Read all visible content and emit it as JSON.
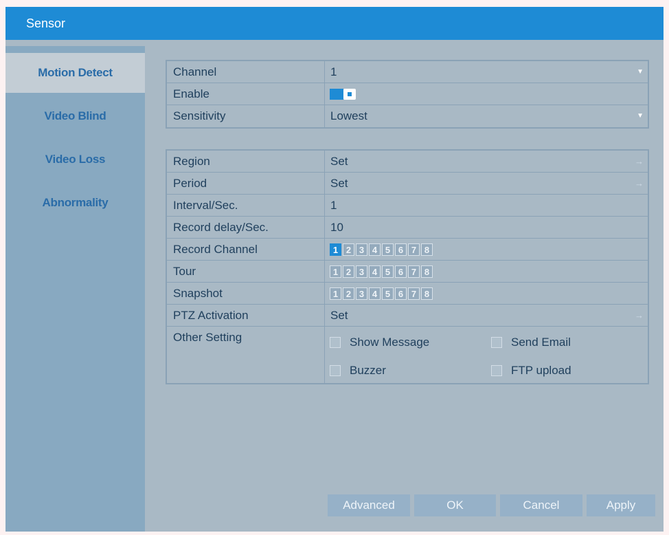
{
  "title": "Sensor",
  "sidebar": {
    "items": [
      {
        "label": "Motion Detect"
      },
      {
        "label": "Video Blind"
      },
      {
        "label": "Video Loss"
      },
      {
        "label": "Abnormality"
      }
    ],
    "active": "Motion Detect"
  },
  "form1": {
    "channel": {
      "label": "Channel",
      "value": "1"
    },
    "enable": {
      "label": "Enable",
      "checked": true
    },
    "sensitivity": {
      "label": "Sensitivity",
      "value": "Lowest"
    }
  },
  "form2": {
    "region": {
      "label": "Region",
      "value": "Set"
    },
    "period": {
      "label": "Period",
      "value": "Set"
    },
    "interval": {
      "label": "Interval/Sec.",
      "value": "1"
    },
    "record_delay": {
      "label": "Record delay/Sec.",
      "value": "10"
    },
    "record_channel": {
      "label": "Record Channel",
      "channels": [
        "1",
        "2",
        "3",
        "4",
        "5",
        "6",
        "7",
        "8"
      ],
      "selected": [
        "1"
      ]
    },
    "tour": {
      "label": "Tour",
      "channels": [
        "1",
        "2",
        "3",
        "4",
        "5",
        "6",
        "7",
        "8"
      ],
      "selected": []
    },
    "snapshot": {
      "label": "Snapshot",
      "channels": [
        "1",
        "2",
        "3",
        "4",
        "5",
        "6",
        "7",
        "8"
      ],
      "selected": []
    },
    "ptz": {
      "label": "PTZ Activation",
      "value": "Set"
    },
    "other": {
      "label": "Other Setting",
      "options": {
        "show_message": "Show Message",
        "send_email": "Send Email",
        "buzzer": "Buzzer",
        "ftp_upload": "FTP upload"
      }
    }
  },
  "buttons": {
    "advanced": "Advanced",
    "ok": "OK",
    "cancel": "Cancel",
    "apply": "Apply"
  },
  "colors": {
    "accent": "#1e8bd5",
    "background": "#a9b9c5",
    "sidebar": "#88a9c1"
  }
}
